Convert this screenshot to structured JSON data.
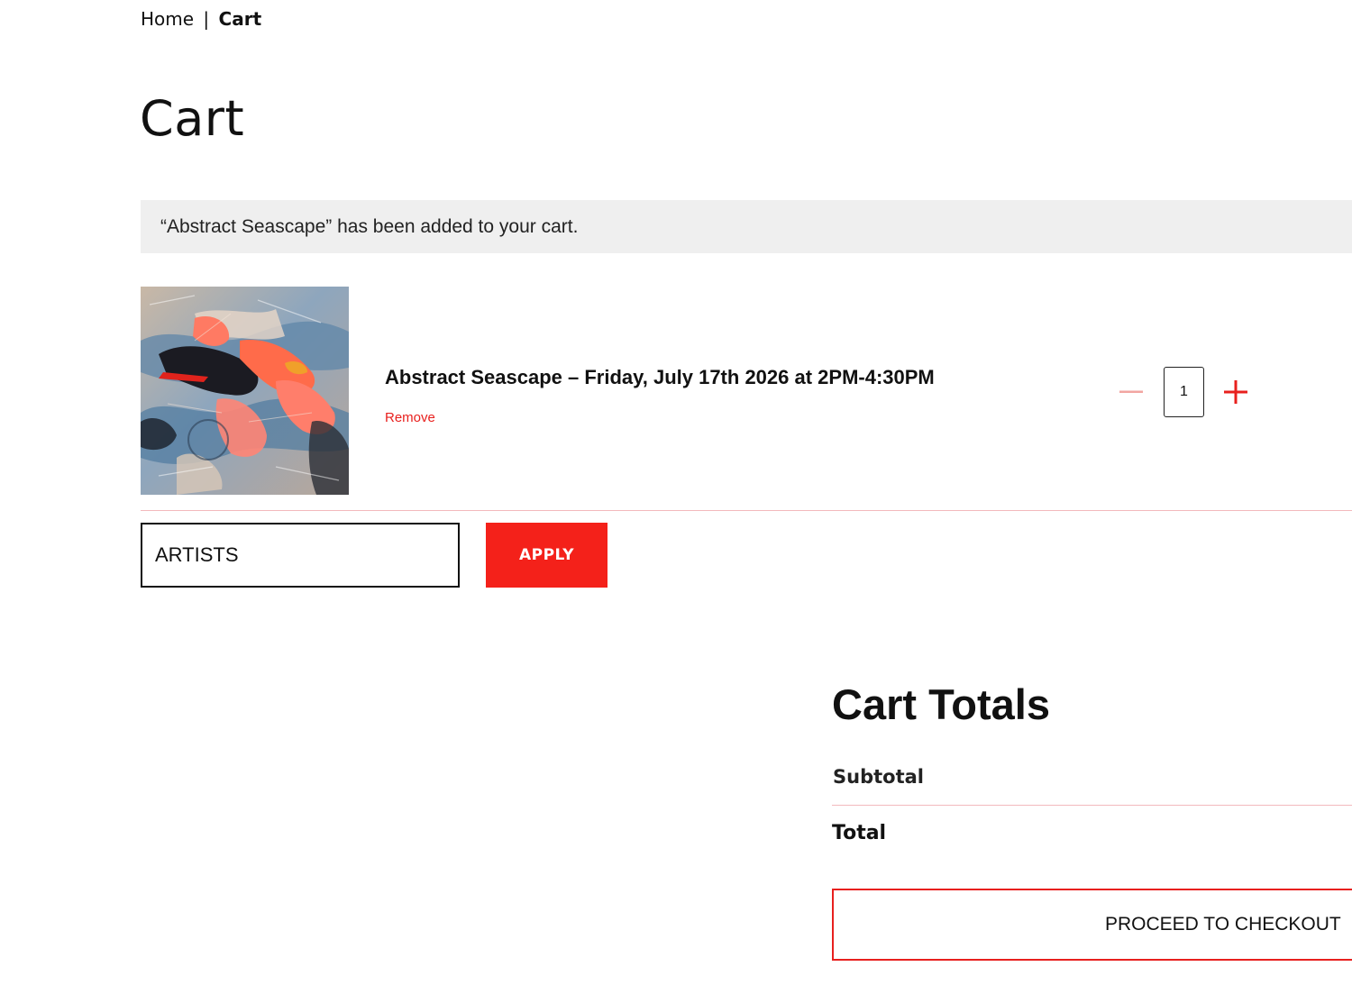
{
  "breadcrumb": {
    "home": "Home",
    "separator": "|",
    "current": "Cart"
  },
  "page_title": "Cart",
  "notice": {
    "message": "“Abstract Seascape” has been added to your cart."
  },
  "cart_item": {
    "thumbnail_icon": "abstract-painting-image",
    "title": "Abstract Seascape – Friday, July 17th 2026 at 2PM-4:30PM",
    "remove_label": "Remove",
    "quantity": "1",
    "decrease_icon": "minus-icon",
    "increase_icon": "plus-icon"
  },
  "coupon": {
    "value": "ARTISTS",
    "apply_label": "APPLY"
  },
  "totals": {
    "heading": "Cart Totals",
    "subtotal_label": "Subtotal",
    "total_label": "Total",
    "checkout_label": "PROCEED TO CHECKOUT"
  },
  "colors": {
    "accent_red": "#f4211a",
    "remove_red": "#e8201e",
    "notice_bg": "#efefef",
    "divider_pink": "#f3b9bd"
  }
}
